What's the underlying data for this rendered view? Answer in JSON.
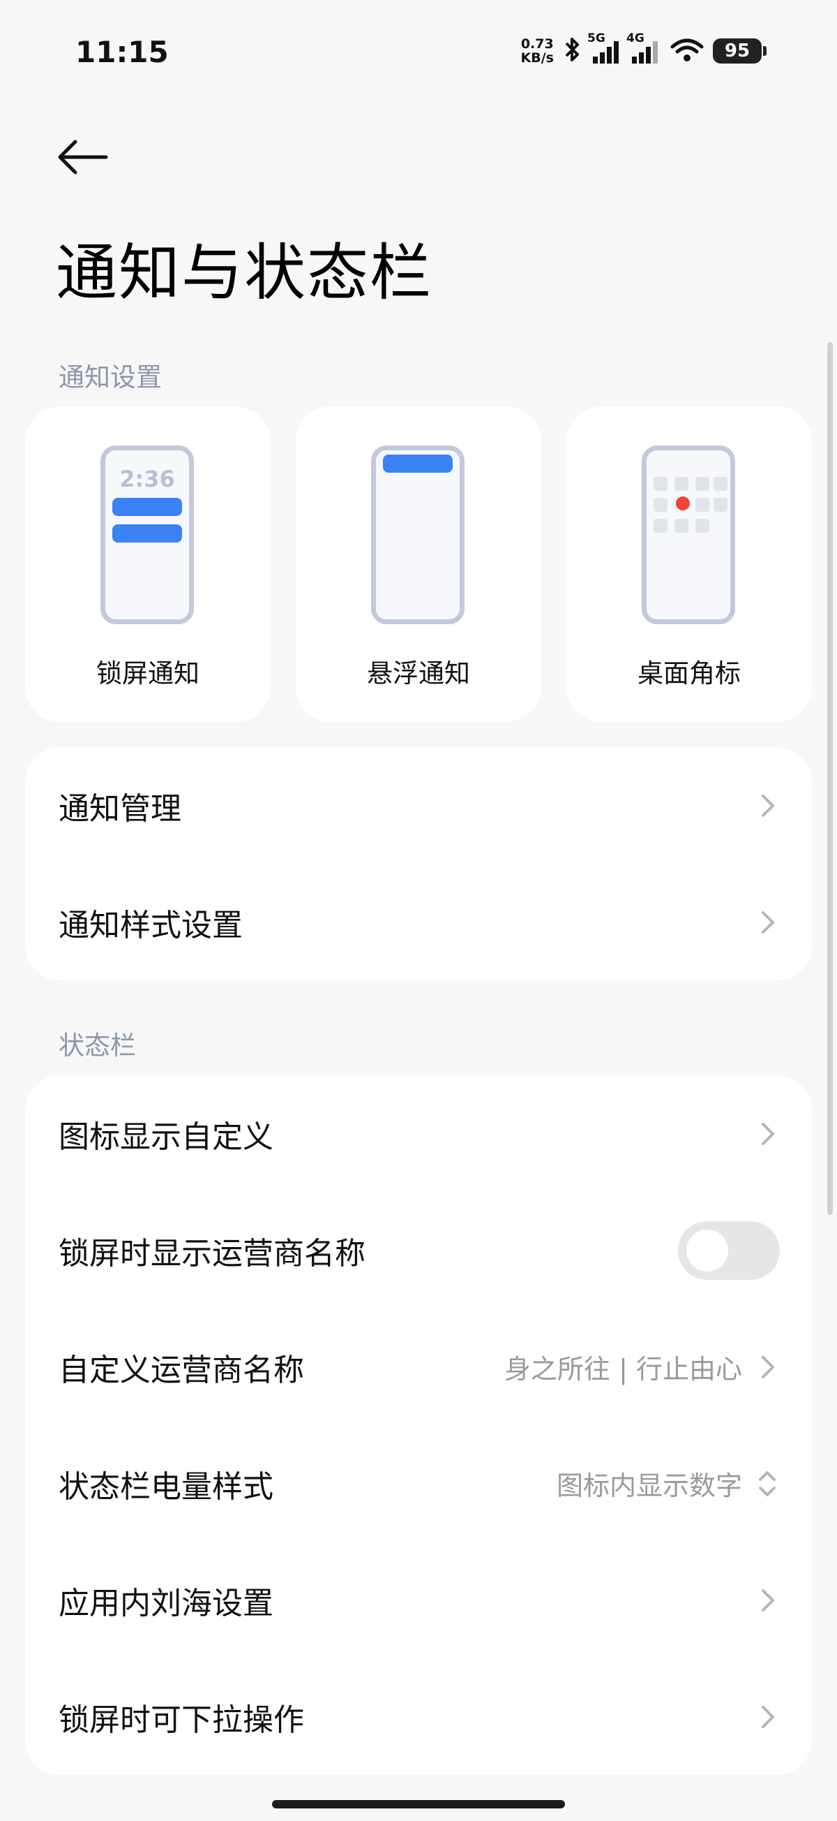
{
  "status_bar": {
    "time": "11:15",
    "speed_value": "0.73",
    "speed_unit": "KB/s",
    "net1": "5G",
    "net2": "4G",
    "battery": "95"
  },
  "header": {
    "title": "通知与状态栏"
  },
  "notification_section": {
    "label": "通知设置",
    "cards": [
      {
        "label": "锁屏通知",
        "clock": "2:36"
      },
      {
        "label": "悬浮通知"
      },
      {
        "label": "桌面角标"
      }
    ]
  },
  "notification_group": {
    "rows": [
      {
        "label": "通知管理"
      },
      {
        "label": "通知样式设置"
      }
    ]
  },
  "statusbar_section": {
    "label": "状态栏"
  },
  "statusbar_group": {
    "rows": [
      {
        "label": "图标显示自定义"
      },
      {
        "label": "锁屏时显示运营商名称",
        "toggle_on": false
      },
      {
        "label": "自定义运营商名称",
        "value": "身之所往 | 行止由心"
      },
      {
        "label": "状态栏电量样式",
        "value": "图标内显示数字"
      },
      {
        "label": "应用内刘海设置"
      },
      {
        "label": "锁屏时可下拉操作"
      }
    ]
  },
  "colors": {
    "accent": "#3a82f6",
    "badge": "#f04438",
    "section_label": "#8d97ac"
  },
  "icons": [
    "back-arrow-icon",
    "chevron-right-icon",
    "chevron-up-down-icon",
    "bluetooth-icon",
    "signal-icon",
    "wifi-icon",
    "battery-icon"
  ]
}
